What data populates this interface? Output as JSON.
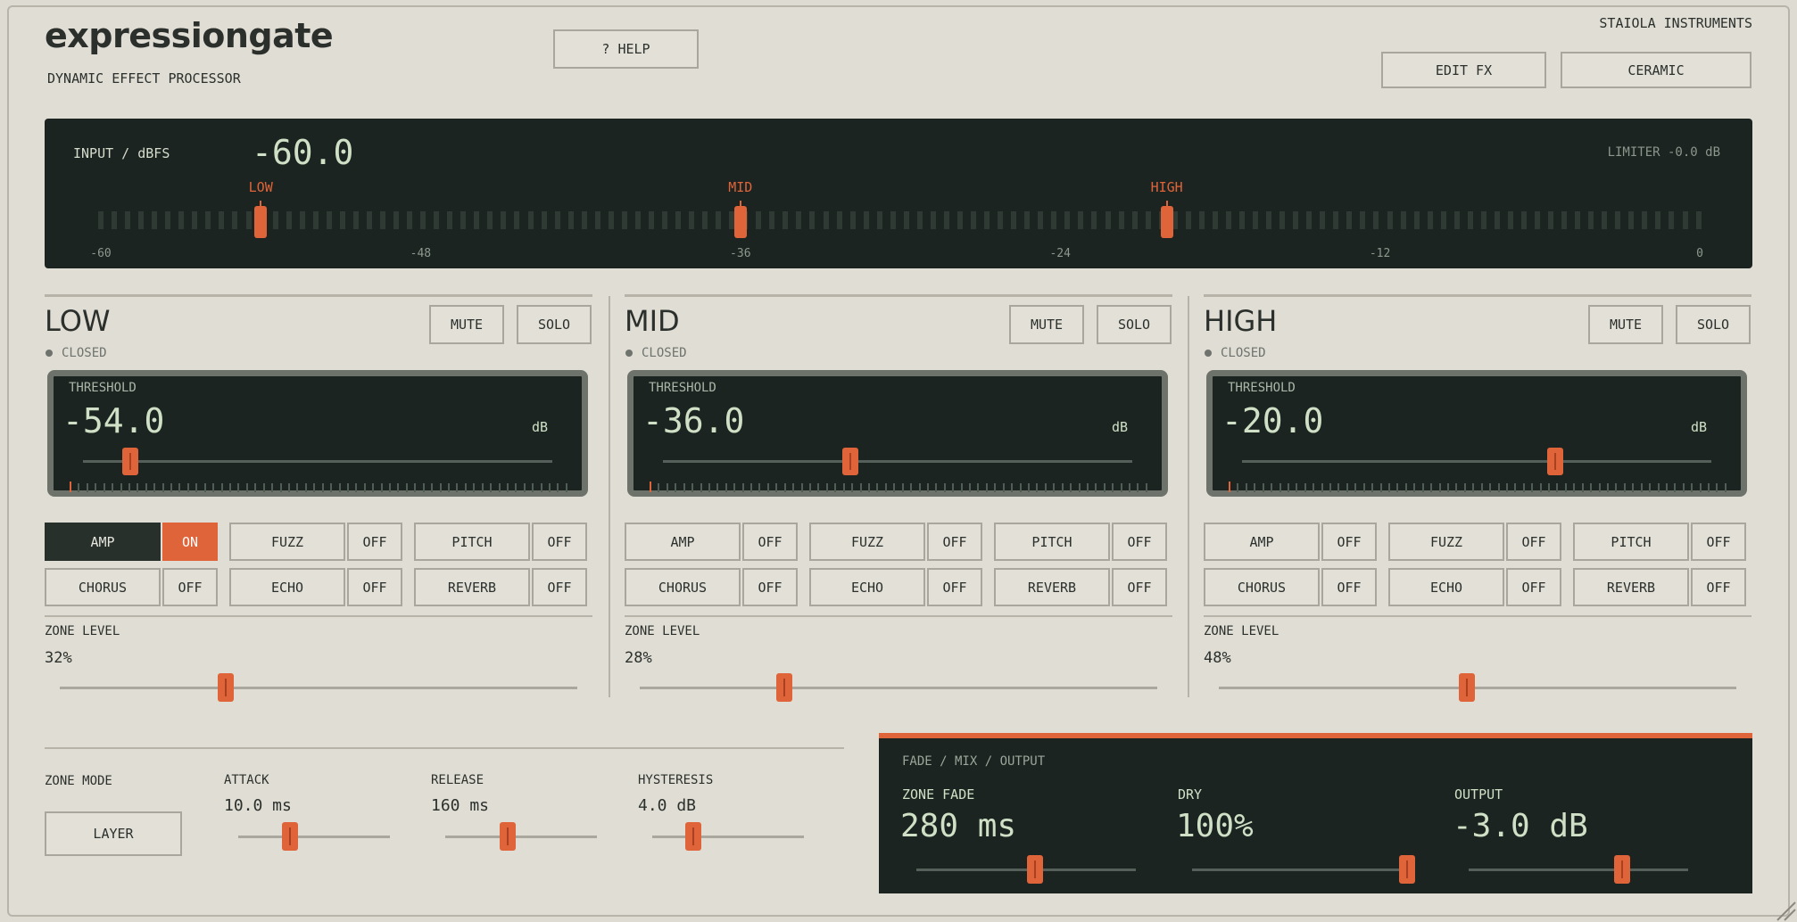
{
  "app": {
    "brand": "expressiongate",
    "subtitle": "DYNAMIC EFFECT PROCESSOR",
    "maker": "STAIOLA INSTRUMENTS",
    "help_label": "? HELP",
    "edit_fx_label": "EDIT FX",
    "theme_label": "CERAMIC"
  },
  "meter": {
    "label": "INPUT / dBFS",
    "value": "-60.0",
    "limiter": "LIMITER  -0.0 dB",
    "scale": [
      "-60",
      "-48",
      "-36",
      "-24",
      "-12",
      "0"
    ],
    "bands": [
      {
        "name": "LOW",
        "db": -54
      },
      {
        "name": "MID",
        "db": -36
      },
      {
        "name": "HIGH",
        "db": -20
      }
    ]
  },
  "zones": [
    {
      "title": "LOW",
      "status": "CLOSED",
      "mute": "MUTE",
      "solo": "SOLO",
      "threshold_label": "THRESHOLD",
      "threshold_value": "-54.0",
      "threshold_unit": "dB",
      "threshold_fraction": 0.1,
      "effects": [
        {
          "name": "AMP",
          "state": "ON",
          "active": true
        },
        {
          "name": "FUZZ",
          "state": "OFF",
          "active": false
        },
        {
          "name": "PITCH",
          "state": "OFF",
          "active": false
        },
        {
          "name": "CHORUS",
          "state": "OFF",
          "active": false
        },
        {
          "name": "ECHO",
          "state": "OFF",
          "active": false
        },
        {
          "name": "REVERB",
          "state": "OFF",
          "active": false
        }
      ],
      "level_label": "ZONE LEVEL",
      "level_value": "32%",
      "level_fraction": 0.32
    },
    {
      "title": "MID",
      "status": "CLOSED",
      "mute": "MUTE",
      "solo": "SOLO",
      "threshold_label": "THRESHOLD",
      "threshold_value": "-36.0",
      "threshold_unit": "dB",
      "threshold_fraction": 0.4,
      "effects": [
        {
          "name": "AMP",
          "state": "OFF",
          "active": false
        },
        {
          "name": "FUZZ",
          "state": "OFF",
          "active": false
        },
        {
          "name": "PITCH",
          "state": "OFF",
          "active": false
        },
        {
          "name": "CHORUS",
          "state": "OFF",
          "active": false
        },
        {
          "name": "ECHO",
          "state": "OFF",
          "active": false
        },
        {
          "name": "REVERB",
          "state": "OFF",
          "active": false
        }
      ],
      "level_label": "ZONE LEVEL",
      "level_value": "28%",
      "level_fraction": 0.28
    },
    {
      "title": "HIGH",
      "status": "CLOSED",
      "mute": "MUTE",
      "solo": "SOLO",
      "threshold_label": "THRESHOLD",
      "threshold_value": "-20.0",
      "threshold_unit": "dB",
      "threshold_fraction": 0.667,
      "effects": [
        {
          "name": "AMP",
          "state": "OFF",
          "active": false
        },
        {
          "name": "FUZZ",
          "state": "OFF",
          "active": false
        },
        {
          "name": "PITCH",
          "state": "OFF",
          "active": false
        },
        {
          "name": "CHORUS",
          "state": "OFF",
          "active": false
        },
        {
          "name": "ECHO",
          "state": "OFF",
          "active": false
        },
        {
          "name": "REVERB",
          "state": "OFF",
          "active": false
        }
      ],
      "level_label": "ZONE LEVEL",
      "level_value": "48%",
      "level_fraction": 0.48
    }
  ],
  "controls": {
    "zone_mode_label": "ZONE MODE",
    "zone_mode_value": "LAYER",
    "attack": {
      "label": "ATTACK",
      "value": "10.0 ms",
      "fraction": 0.34
    },
    "release": {
      "label": "RELEASE",
      "value": "160 ms",
      "fraction": 0.41
    },
    "hysteresis": {
      "label": "HYSTERESIS",
      "value": "4.0 dB",
      "fraction": 0.27
    }
  },
  "output": {
    "title": "FADE / MIX / OUTPUT",
    "zone_fade": {
      "label": "ZONE FADE",
      "value": "280 ms",
      "fraction": 0.54
    },
    "dry": {
      "label": "DRY",
      "value": "100%",
      "fraction": 1.0
    },
    "output": {
      "label": "OUTPUT",
      "value": "-3.0 dB",
      "fraction": 0.7
    }
  },
  "colors": {
    "accent": "#e0643a",
    "panel_dark": "#1b2420",
    "background": "#dedbd2"
  }
}
